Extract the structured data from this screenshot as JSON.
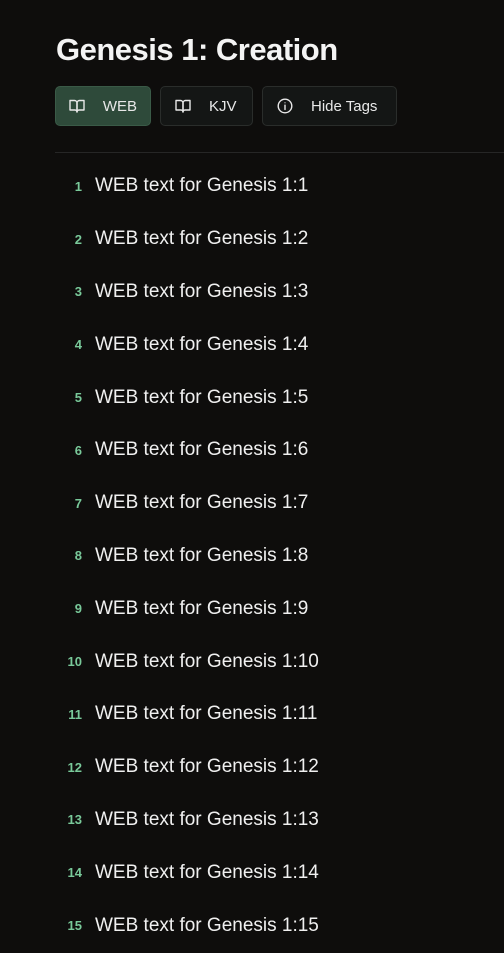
{
  "title": "Genesis 1: Creation",
  "toolbar": {
    "buttons": [
      {
        "label": "WEB",
        "icon": "book-open-icon",
        "active": true
      },
      {
        "label": "KJV",
        "icon": "book-open-icon",
        "active": false
      },
      {
        "label": "Hide Tags",
        "icon": "info-icon",
        "active": false
      }
    ]
  },
  "colors": {
    "background": "#0e0d0c",
    "active_button": "#2e4a3a",
    "verse_number": "#79c99a"
  },
  "verses": [
    {
      "num": "1",
      "text": "WEB text for Genesis 1:1"
    },
    {
      "num": "2",
      "text": "WEB text for Genesis 1:2"
    },
    {
      "num": "3",
      "text": "WEB text for Genesis 1:3"
    },
    {
      "num": "4",
      "text": "WEB text for Genesis 1:4"
    },
    {
      "num": "5",
      "text": "WEB text for Genesis 1:5"
    },
    {
      "num": "6",
      "text": "WEB text for Genesis 1:6"
    },
    {
      "num": "7",
      "text": "WEB text for Genesis 1:7"
    },
    {
      "num": "8",
      "text": "WEB text for Genesis 1:8"
    },
    {
      "num": "9",
      "text": "WEB text for Genesis 1:9"
    },
    {
      "num": "10",
      "text": "WEB text for Genesis 1:10"
    },
    {
      "num": "11",
      "text": "WEB text for Genesis 1:11"
    },
    {
      "num": "12",
      "text": "WEB text for Genesis 1:12"
    },
    {
      "num": "13",
      "text": "WEB text for Genesis 1:13"
    },
    {
      "num": "14",
      "text": "WEB text for Genesis 1:14"
    },
    {
      "num": "15",
      "text": "WEB text for Genesis 1:15"
    }
  ]
}
